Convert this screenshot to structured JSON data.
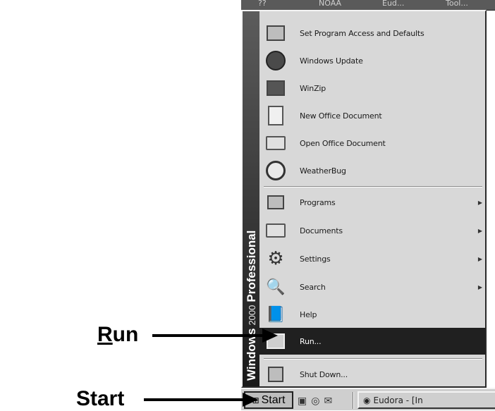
{
  "top_strip": {
    "texts": [
      "??",
      "NOAA",
      "Eud...",
      "Tool..."
    ]
  },
  "banner": {
    "brand": "Windows",
    "version": "2000",
    "edition": "Professional"
  },
  "menu": {
    "top_items": [
      {
        "label": "Set Program Access and Defaults",
        "icon": "program-access-icon"
      },
      {
        "label": "Windows Update",
        "icon": "windows-update-icon"
      },
      {
        "label": "WinZip",
        "icon": "winzip-icon"
      },
      {
        "label": "New Office Document",
        "icon": "new-office-document-icon"
      },
      {
        "label": "Open Office Document",
        "icon": "open-office-document-icon"
      },
      {
        "label": "WeatherBug",
        "icon": "weatherbug-icon"
      }
    ],
    "main_items": [
      {
        "label": "Programs",
        "icon": "programs-icon",
        "submenu": true
      },
      {
        "label": "Documents",
        "icon": "documents-icon",
        "submenu": true
      },
      {
        "label": "Settings",
        "icon": "settings-icon",
        "submenu": true
      },
      {
        "label": "Search",
        "icon": "search-icon",
        "submenu": true
      },
      {
        "label": "Help",
        "icon": "help-icon",
        "submenu": false
      },
      {
        "label": "Run...",
        "icon": "run-icon",
        "submenu": false,
        "highlighted": true
      }
    ],
    "shutdown": {
      "label": "Shut Down...",
      "icon": "shutdown-icon"
    }
  },
  "taskbar": {
    "start_label": "Start",
    "task_label": "Eudora - [In"
  },
  "callouts": {
    "run_prefix": "R",
    "run_rest": "un",
    "start": "Start"
  },
  "colors": {
    "menu_bg": "#d8d8d8",
    "highlight": "#202020",
    "banner": "#1a1a1a"
  }
}
